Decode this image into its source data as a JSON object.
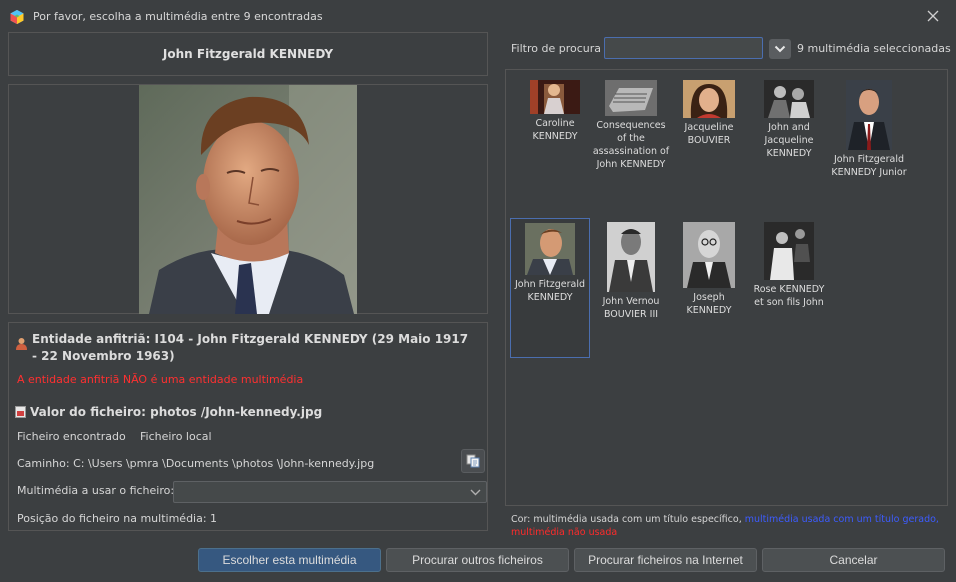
{
  "window": {
    "title": "Por favor, escolha a multimédia entre 9 encontradas",
    "icons": {
      "app": "app-cube-icon",
      "close": "close-icon"
    }
  },
  "person_name": "John Fitzgerald KENNEDY",
  "portrait": {
    "name": "portrait-image"
  },
  "info": {
    "host_entity": "Entidade anfitriã: I104 - John Fitzgerald KENNEDY (29 Maio 1917 - 22 Novembro 1963)",
    "warning": "A entidade anfitriã NÃO é uma entidade multimédia",
    "file_value": "Valor do ficheiro: photos /John-kennedy.jpg",
    "found_label": "Ficheiro encontrado",
    "found_value": "Ficheiro local",
    "path": "Caminho: C: \\Users \\pmra \\Documents \\photos \\John-kennedy.jpg",
    "use_label": "Multimédia a usar o ficheiro:",
    "use_value": "",
    "position": "Posição do ficheiro na multimédia: 1"
  },
  "filter": {
    "label": "Filtro de procura",
    "value": "",
    "count": "9 multimédia seleccionadas"
  },
  "media": [
    {
      "caption": "Caroline KENNEDY"
    },
    {
      "caption": "Consequences of the assassination of John KENNEDY"
    },
    {
      "caption": "Jacqueline BOUVIER"
    },
    {
      "caption": "John and Jacqueline KENNEDY"
    },
    {
      "caption": "John Fitzgerald KENNEDY Junior"
    },
    {
      "caption": "John Fitzgerald KENNEDY"
    },
    {
      "caption": "John Vernou BOUVIER III"
    },
    {
      "caption": "Joseph KENNEDY"
    },
    {
      "caption": "Rose KENNEDY et son fils John"
    }
  ],
  "legend": {
    "normal": "Cor: multimédia usada com um título específico,",
    "blue": "multimédia usada com um título gerado,",
    "red": "multimédia não usada",
    "colors": {
      "blue": "#3c5cff",
      "red": "#ff2b2b"
    }
  },
  "buttons": {
    "choose": "Escolher esta multimédia",
    "browse": "Procurar outros ficheiros",
    "internet": "Procurar ficheiros na Internet",
    "cancel": "Cancelar"
  }
}
